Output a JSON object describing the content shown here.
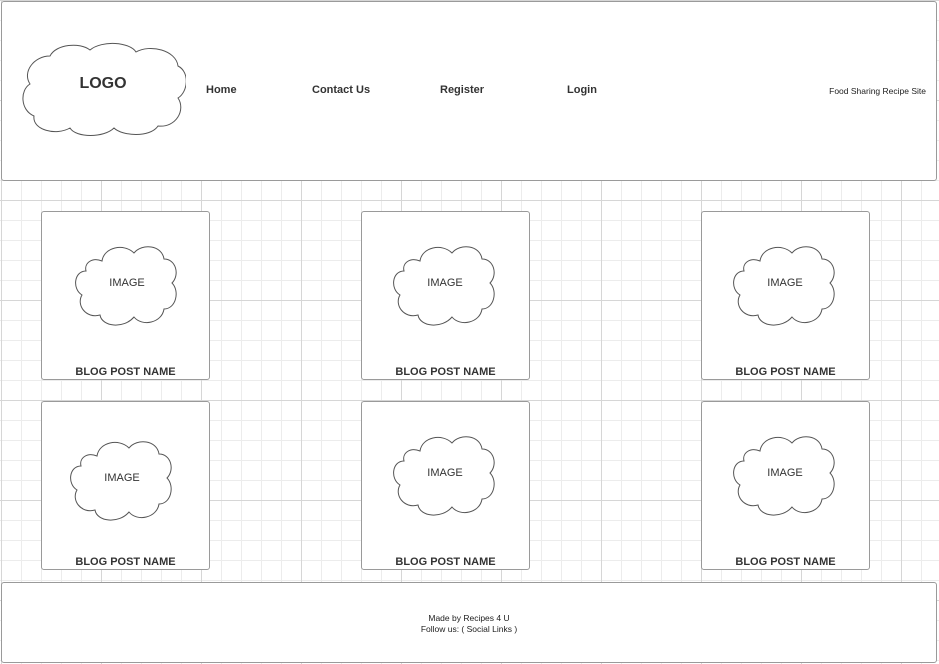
{
  "header": {
    "logo_text": "LOGO",
    "nav": [
      {
        "label": "Home"
      },
      {
        "label": "Contact Us"
      },
      {
        "label": "Register"
      },
      {
        "label": "Login"
      }
    ],
    "site_name": "Food Sharing Recipe Site"
  },
  "posts": [
    {
      "image_label": "IMAGE",
      "name": "BLOG POST NAME"
    },
    {
      "image_label": "IMAGE",
      "name": "BLOG POST NAME"
    },
    {
      "image_label": "IMAGE",
      "name": "BLOG POST NAME"
    },
    {
      "image_label": "IMAGE",
      "name": "BLOG POST NAME"
    },
    {
      "image_label": "IMAGE",
      "name": "BLOG POST NAME"
    },
    {
      "image_label": "IMAGE",
      "name": "BLOG POST NAME"
    }
  ],
  "footer": {
    "made_by": "Made by Recipes 4 U",
    "follow": "Follow us: ( Social Links )"
  }
}
